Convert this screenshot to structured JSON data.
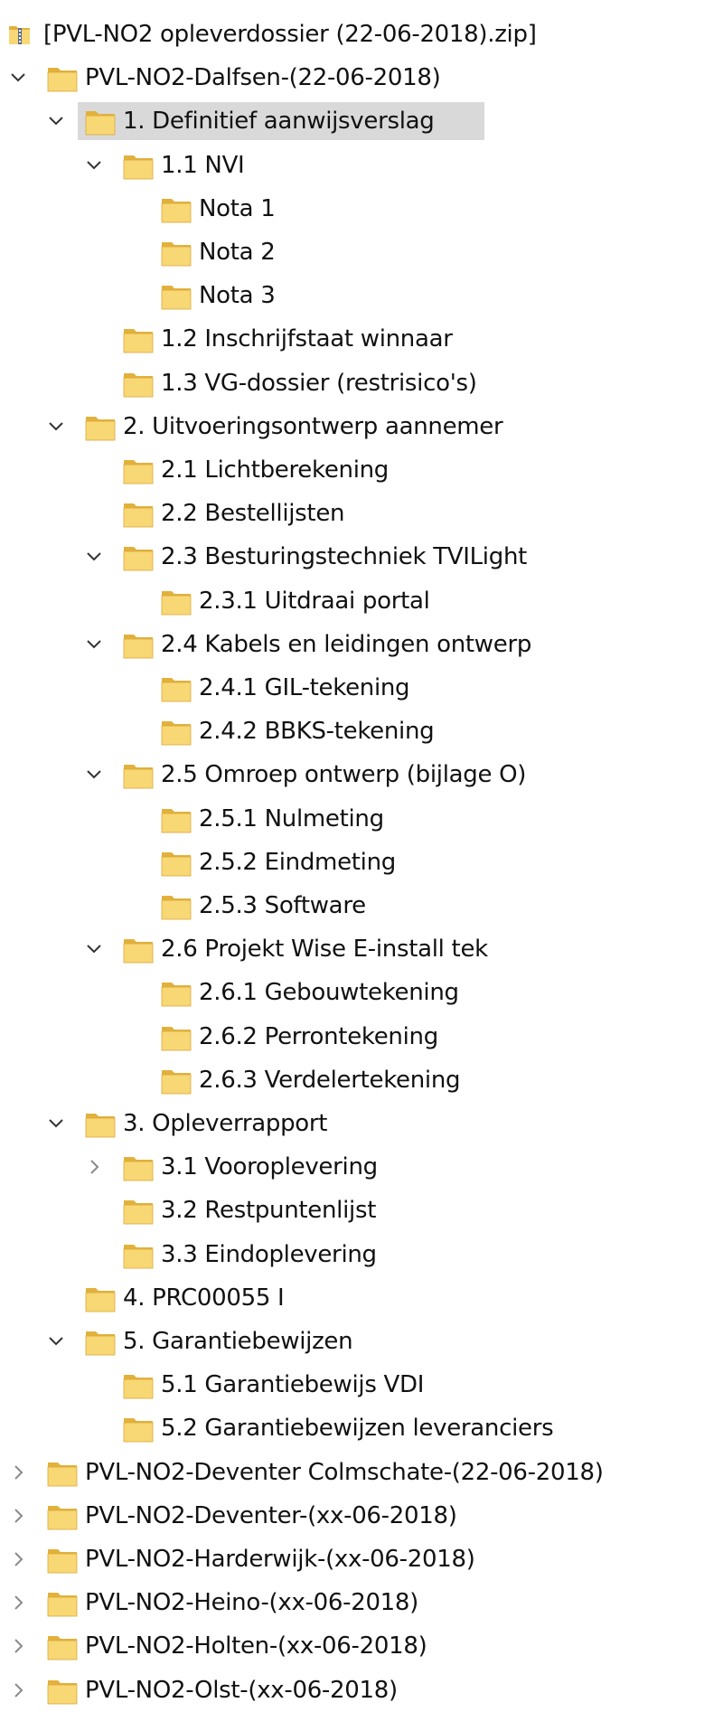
{
  "theme": {
    "folder_fill": "#f8d775",
    "folder_tab": "#e2b13c",
    "chevron_color": "#333333",
    "selection_bg": "#d9d9d9"
  },
  "tree": [
    {
      "label": "[PVL-NO2 opleverdossier (22-06-2018).zip]",
      "depth": 0,
      "chevron": "none",
      "icon": "zip-icon"
    },
    {
      "label": "PVL-NO2-Dalfsen-(22-06-2018)",
      "depth": 0,
      "chevron": "expanded",
      "icon": "folder-icon"
    },
    {
      "label": "1. Definitief aanwijsverslag",
      "depth": 1,
      "chevron": "expanded",
      "icon": "folder-icon",
      "selected": true
    },
    {
      "label": "1.1 NVI",
      "depth": 2,
      "chevron": "expanded",
      "icon": "folder-icon"
    },
    {
      "label": "Nota 1",
      "depth": 3,
      "chevron": "none",
      "icon": "folder-icon"
    },
    {
      "label": "Nota 2",
      "depth": 3,
      "chevron": "none",
      "icon": "folder-icon"
    },
    {
      "label": "Nota 3",
      "depth": 3,
      "chevron": "none",
      "icon": "folder-icon"
    },
    {
      "label": "1.2 Inschrijfstaat winnaar",
      "depth": 2,
      "chevron": "none",
      "icon": "folder-icon"
    },
    {
      "label": "1.3 VG-dossier (restrisico's)",
      "depth": 2,
      "chevron": "none",
      "icon": "folder-icon"
    },
    {
      "label": "2. Uitvoeringsontwerp aannemer",
      "depth": 1,
      "chevron": "expanded",
      "icon": "folder-icon"
    },
    {
      "label": "2.1 Lichtberekening",
      "depth": 2,
      "chevron": "none",
      "icon": "folder-icon"
    },
    {
      "label": "2.2 Bestellijsten",
      "depth": 2,
      "chevron": "none",
      "icon": "folder-icon"
    },
    {
      "label": "2.3 Besturingstechniek TVILight",
      "depth": 2,
      "chevron": "expanded",
      "icon": "folder-icon"
    },
    {
      "label": "2.3.1 Uitdraai portal",
      "depth": 3,
      "chevron": "none",
      "icon": "folder-icon"
    },
    {
      "label": "2.4 Kabels en leidingen ontwerp",
      "depth": 2,
      "chevron": "expanded",
      "icon": "folder-icon"
    },
    {
      "label": "2.4.1 GIL-tekening",
      "depth": 3,
      "chevron": "none",
      "icon": "folder-icon"
    },
    {
      "label": "2.4.2 BBKS-tekening",
      "depth": 3,
      "chevron": "none",
      "icon": "folder-icon"
    },
    {
      "label": "2.5 Omroep ontwerp (bijlage O)",
      "depth": 2,
      "chevron": "expanded",
      "icon": "folder-icon"
    },
    {
      "label": "2.5.1 Nulmeting",
      "depth": 3,
      "chevron": "none",
      "icon": "folder-icon"
    },
    {
      "label": "2.5.2 Eindmeting",
      "depth": 3,
      "chevron": "none",
      "icon": "folder-icon"
    },
    {
      "label": "2.5.3 Software",
      "depth": 3,
      "chevron": "none",
      "icon": "folder-icon"
    },
    {
      "label": "2.6 Projekt Wise E-install tek",
      "depth": 2,
      "chevron": "expanded",
      "icon": "folder-icon"
    },
    {
      "label": "2.6.1 Gebouwtekening",
      "depth": 3,
      "chevron": "none",
      "icon": "folder-icon"
    },
    {
      "label": "2.6.2 Perrontekening",
      "depth": 3,
      "chevron": "none",
      "icon": "folder-icon"
    },
    {
      "label": "2.6.3 Verdelertekening",
      "depth": 3,
      "chevron": "none",
      "icon": "folder-icon"
    },
    {
      "label": "3. Opleverrapport",
      "depth": 1,
      "chevron": "expanded",
      "icon": "folder-icon"
    },
    {
      "label": "3.1 Vooroplevering",
      "depth": 2,
      "chevron": "collapsed",
      "icon": "folder-icon"
    },
    {
      "label": "3.2 Restpuntenlijst",
      "depth": 2,
      "chevron": "none",
      "icon": "folder-icon"
    },
    {
      "label": "3.3 Eindoplevering",
      "depth": 2,
      "chevron": "none",
      "icon": "folder-icon"
    },
    {
      "label": "4. PRC00055 I",
      "depth": 1,
      "chevron": "none",
      "icon": "folder-icon"
    },
    {
      "label": "5. Garantiebewijzen",
      "depth": 1,
      "chevron": "expanded",
      "icon": "folder-icon"
    },
    {
      "label": "5.1 Garantiebewijs VDI",
      "depth": 2,
      "chevron": "none",
      "icon": "folder-icon"
    },
    {
      "label": "5.2 Garantiebewijzen leveranciers",
      "depth": 2,
      "chevron": "none",
      "icon": "folder-icon"
    },
    {
      "label": "PVL-NO2-Deventer Colmschate-(22-06-2018)",
      "depth": 0,
      "chevron": "collapsed",
      "icon": "folder-icon"
    },
    {
      "label": "PVL-NO2-Deventer-(xx-06-2018)",
      "depth": 0,
      "chevron": "collapsed",
      "icon": "folder-icon"
    },
    {
      "label": "PVL-NO2-Harderwijk-(xx-06-2018)",
      "depth": 0,
      "chevron": "collapsed",
      "icon": "folder-icon"
    },
    {
      "label": "PVL-NO2-Heino-(xx-06-2018)",
      "depth": 0,
      "chevron": "collapsed",
      "icon": "folder-icon"
    },
    {
      "label": "PVL-NO2-Holten-(xx-06-2018)",
      "depth": 0,
      "chevron": "collapsed",
      "icon": "folder-icon"
    },
    {
      "label": "PVL-NO2-Olst-(xx-06-2018)",
      "depth": 0,
      "chevron": "collapsed",
      "icon": "folder-icon"
    }
  ]
}
